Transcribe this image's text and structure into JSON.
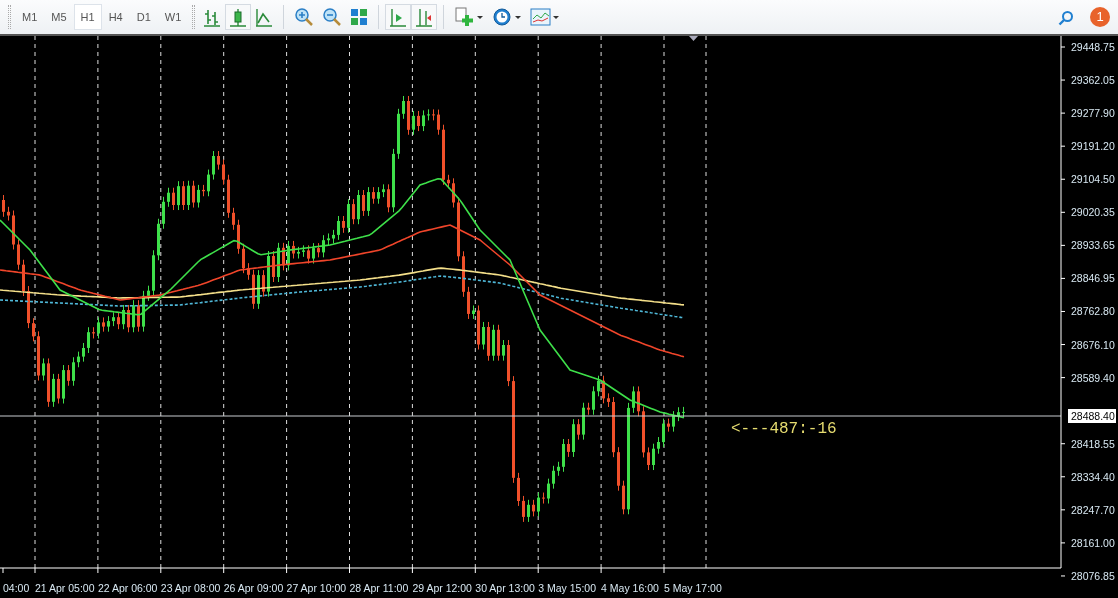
{
  "toolbar": {
    "timeframes": [
      {
        "label": "M1",
        "selected": false
      },
      {
        "label": "M5",
        "selected": false
      },
      {
        "label": "H1",
        "selected": true
      },
      {
        "label": "H4",
        "selected": false
      },
      {
        "label": "D1",
        "selected": false
      },
      {
        "label": "W1",
        "selected": false
      }
    ],
    "chart_types": [
      {
        "kind": "bars",
        "selected": false
      },
      {
        "kind": "candles",
        "selected": true
      },
      {
        "kind": "line",
        "selected": false
      }
    ],
    "toggles": [
      {
        "kind": "autoscroll",
        "on": true
      },
      {
        "kind": "shift",
        "on": true
      }
    ],
    "notifications": "1"
  },
  "chart": {
    "price_scale": [
      "29448.75",
      "29362.05",
      "29277.90",
      "29191.20",
      "29104.50",
      "29020.35",
      "28933.65",
      "28846.95",
      "28762.80",
      "28676.10",
      "28589.40",
      "28418.55",
      "28334.40",
      "28247.70",
      "28161.00",
      "28076.85"
    ],
    "current_price": "28488.40",
    "time_scale": [
      "04:00",
      "21 Apr 05:00",
      "22 Apr 06:00",
      "23 Apr 08:00",
      "26 Apr 09:00",
      "27 Apr 10:00",
      "28 Apr 11:00",
      "29 Apr 12:00",
      "30 Apr 13:00",
      "3 May 15:00",
      "4 May 16:00",
      "5 May 17:00"
    ],
    "annotation": "<---487:-16"
  }
}
